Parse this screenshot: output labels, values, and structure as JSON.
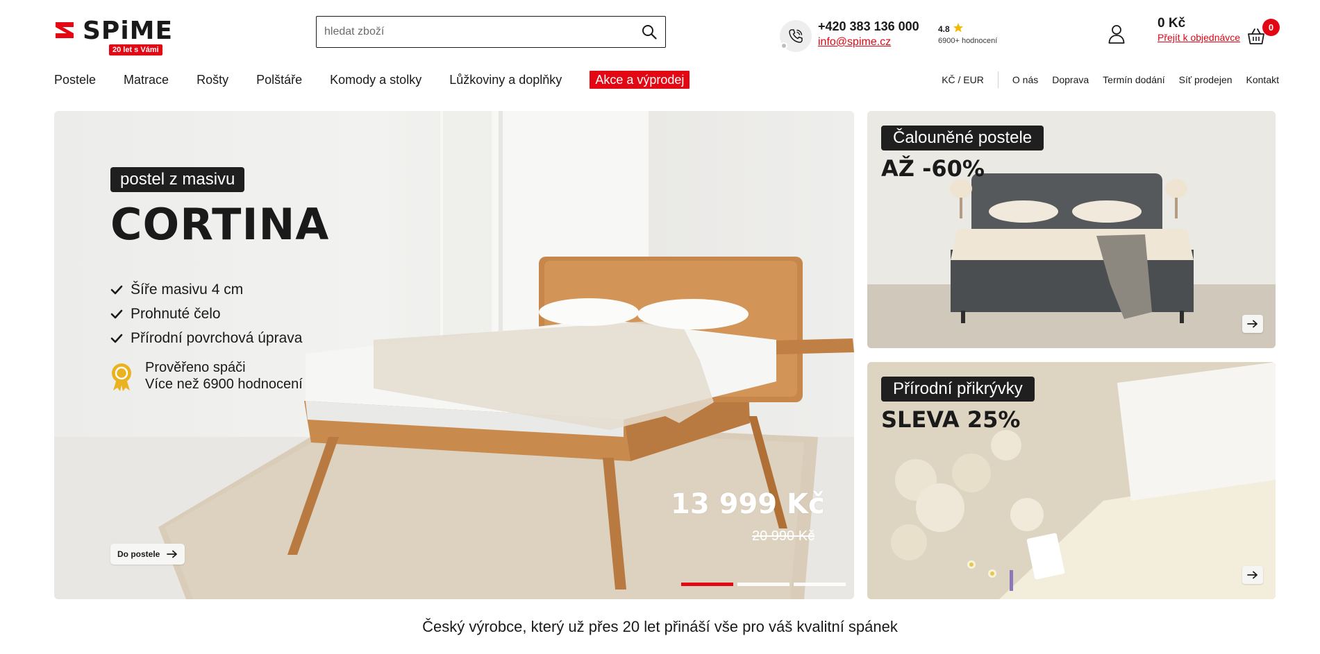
{
  "header": {
    "logo_text": "SPiME",
    "logo_badge": "20 let s Vámi",
    "search": {
      "placeholder": "hledat zboží",
      "value": ""
    },
    "contact": {
      "phone": "+420 383 136 000",
      "email": "info@spime.cz"
    },
    "rating": {
      "score": "4.8",
      "count_label": "6900+ hodnocení"
    },
    "cart": {
      "total": "0 Kč",
      "checkout_label": "Přejít k objednávce",
      "count": "0"
    }
  },
  "nav": {
    "main": [
      {
        "label": "Postele"
      },
      {
        "label": "Matrace"
      },
      {
        "label": "Rošty"
      },
      {
        "label": "Polštáře"
      },
      {
        "label": "Komody a stolky"
      },
      {
        "label": "Lůžkoviny a doplňky"
      }
    ],
    "sale_label": "Akce a výprodej",
    "currency_label": "KČ / EUR",
    "secondary": [
      {
        "label": "O nás"
      },
      {
        "label": "Doprava"
      },
      {
        "label": "Termín dodání"
      },
      {
        "label": "Síť prodejen"
      },
      {
        "label": "Kontakt"
      }
    ]
  },
  "hero": {
    "tag": "postel z masivu",
    "title": "CORTINA",
    "features": [
      {
        "label": "Šíře masivu 4 cm"
      },
      {
        "label": "Prohnuté čelo"
      },
      {
        "label": "Přírodní povrchová úprava"
      }
    ],
    "badge_line1": "Prověřeno spáči",
    "badge_line2": "Více než 6900 hodnocení",
    "price": "13 999 Kč",
    "old_price": "20 990 Kč",
    "cta_label": "Do postele",
    "slides_total": 3,
    "active_slide": 1
  },
  "promos": [
    {
      "tag": "Čalouněné postele",
      "headline": "AŽ -60%"
    },
    {
      "tag": "Přírodní přikrývky",
      "headline": "SLEVA 25%"
    }
  ],
  "tagline": "Český výrobce, který už přes 20 let přináší vše pro váš kvalitní spánek",
  "colors": {
    "brand_red": "#e30613",
    "text_dark": "#1a1a1a",
    "tag_background": "#1f1f1f",
    "badge_gold": "#e9b21e"
  }
}
